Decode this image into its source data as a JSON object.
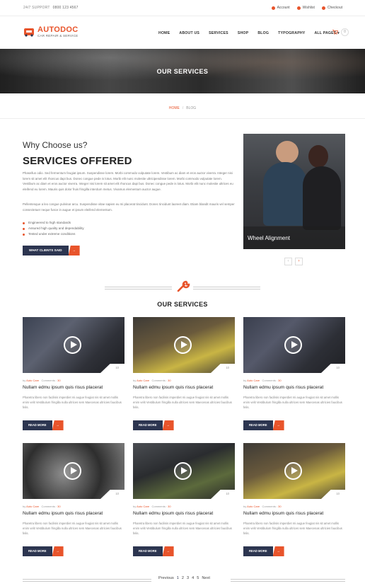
{
  "topbar": {
    "support_label": "24/7 SUPPORT",
    "phone": "0800 123 4567",
    "links": [
      {
        "label": "Account",
        "icon": "user-icon"
      },
      {
        "label": "Wishlist",
        "icon": "heart-icon"
      },
      {
        "label": "Checkout",
        "icon": "checkout-icon"
      }
    ]
  },
  "logo": {
    "brand": "AUTODOC",
    "tagline": "CAR REPAIR & SERVICE"
  },
  "nav": [
    "HOME",
    "ABOUT US",
    "SERVICES",
    "SHOP",
    "BLOG",
    "TYPOGRAPHY",
    "ALL PAGES ▾"
  ],
  "cart": {
    "count": "0"
  },
  "hero": {
    "title": "OUR SERVICES"
  },
  "breadcrumb": {
    "home": "HOME",
    "separator": "/",
    "current": "BLOG"
  },
  "about": {
    "kicker": "Why Choose us?",
    "title": "SERVICES OFFERED",
    "para1": "Phasellus odio. Sed fermentum feugiat ipsum. Suspendisse lorem. Morbi commodo vulputate lorem. Vestibum ac diam et eros auctor viverra. Integer nisi lorem sit amet elit rhoncus dapi bus. Donec congue pede is lotus. Morbi elit nunc molestie ultricipendisse lorem. Morbi commodo vulputate lorem. Vestibum ac diam et eros auctor viverra. Integer nisi lorem sit amet elit rhoncus dapi bus. Donec congue pede is lotus. Morbi elit nunc molestie ultrices eu eleifend eu lorem. Mauris quis dolor fruis fringilla interdum metus. Vivamus elementum auctor augue.",
    "para2": "Pellentesque a leo congue pulvinar arcu. Suspendisse vitae sapien eu mi placerat tincidunt. Donec tincidunt laoreet diam. Etiam blandit mauris vel semper consectetuer neque fusce in augue et ipsum eleifend elementum.",
    "checks": [
      "Engineered to high standards",
      "Assured high quality and dependability",
      "Tested under extreme conditions"
    ],
    "button": "WHAT CLIENTS SAID",
    "arrow": "→",
    "feature_caption": "Wheel Alignment",
    "prev": "‹",
    "next": "›"
  },
  "services_title": "OUR SERVICES",
  "cards": [
    {
      "by": "by",
      "author": "Auto Care",
      "comments_label": "Comments :",
      "comments": "30",
      "count": "10",
      "title": "Nullam edmu ipsum quis risus placerat",
      "desc": "Pharetra libero non facilisis imperdiet mi augue feugiat nis sit amet mollis enim velit Vestibulum fringilla nulla ultrices sem Maecenas ultricies faucibus felis.",
      "button": "READ MORE",
      "arrow": "→"
    },
    {
      "by": "by",
      "author": "Auto Care",
      "comments_label": "Comments :",
      "comments": "30",
      "count": "10",
      "title": "Nullam edmu ipsum quis risus placerat",
      "desc": "Pharetra libero non facilisis imperdiet mi augue feugiat nis sit amet mollis enim velit Vestibulum fringilla nulla ultrices sem Maecenas ultricies faucibus felis.",
      "button": "READ MORE",
      "arrow": "→"
    },
    {
      "by": "by",
      "author": "Auto Care",
      "comments_label": "Comments :",
      "comments": "30",
      "count": "10",
      "title": "Nullam edmu ipsum quis risus placerat",
      "desc": "Pharetra libero non facilisis imperdiet mi augue feugiat nis sit amet mollis enim velit Vestibulum fringilla nulla ultrices sem Maecenas ultricies faucibus felis.",
      "button": "READ MORE",
      "arrow": "→"
    },
    {
      "by": "by",
      "author": "Auto Care",
      "comments_label": "Comments :",
      "comments": "30",
      "count": "10",
      "title": "Nullam edmu ipsum quis risus placerat",
      "desc": "Pharetra libero non facilisis imperdiet mi augue feugiat nis sit amet mollis enim velit Vestibulum fringilla nulla ultrices sem Maecenas ultricies faucibus felis.",
      "button": "READ MORE",
      "arrow": "→"
    },
    {
      "by": "by",
      "author": "Auto Care",
      "comments_label": "Comments :",
      "comments": "30",
      "count": "10",
      "title": "Nullam edmu ipsum quis risus placerat",
      "desc": "Pharetra libero non facilisis imperdiet mi augue feugiat nis sit amet mollis enim velit Vestibulum fringilla nulla ultrices sem Maecenas ultricies faucibus felis.",
      "button": "READ MORE",
      "arrow": "→"
    },
    {
      "by": "by",
      "author": "Auto Care",
      "comments_label": "Comments :",
      "comments": "30",
      "count": "10",
      "title": "Nullam edmu ipsum quis risus placerat",
      "desc": "Pharetra libero non facilisis imperdiet mi augue feugiat nis sit amet mollis enim velit Vestibulum fringilla nulla ultrices sem Maecenas ultricies faucibus felis.",
      "button": "READ MORE",
      "arrow": "→"
    }
  ],
  "pagination": {
    "previous": "Previous",
    "pages": [
      "1",
      "2",
      "3",
      "4",
      "5"
    ],
    "next": "Next"
  },
  "colors": {
    "accent": "#e8542b",
    "navy": "#2c3550"
  }
}
